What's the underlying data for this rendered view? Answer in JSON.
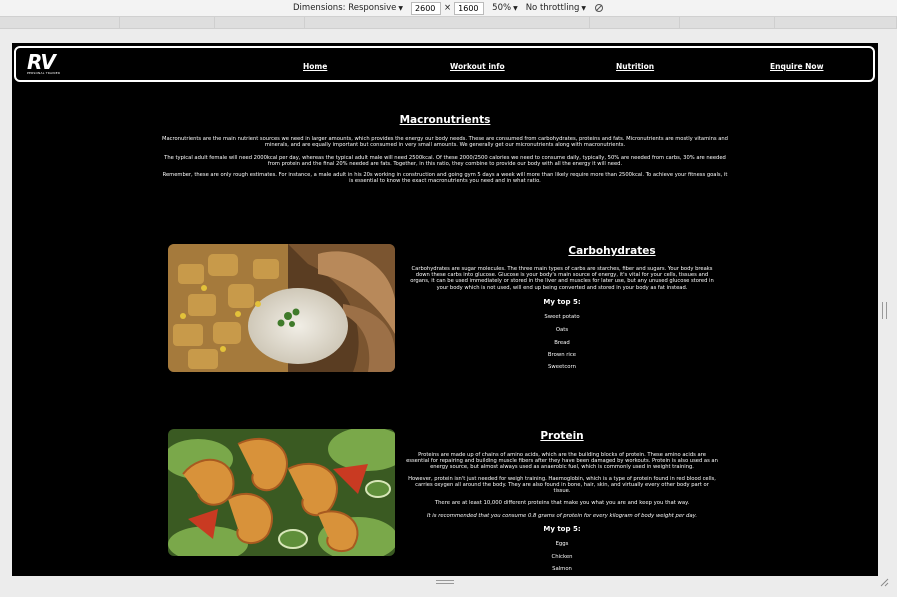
{
  "devtools": {
    "dimensions_label": "Dimensions: Responsive",
    "width": "2600",
    "times": "×",
    "height": "1600",
    "zoom": "50%",
    "throttling": "No throttling"
  },
  "nav": {
    "logo_text": "RV",
    "logo_sub": "PERSONAL TRAINER",
    "links": [
      "Home",
      "Workout info",
      "Nutrition",
      "Enquire Now"
    ]
  },
  "macro": {
    "title": "Macronutrients",
    "p1": "Macronutrients are the main nutrient sources we need in larger amounts, which provides the energy our body needs. These are consumed from carbohydrates, proteins and fats. Micronutrients are mostly vitamins and minerals, and are equally important but consumed in very small amounts. We generally get our micronutrients along with macronutrients.",
    "p2": "The typical adult female will need 2000kcal per day, whereas the typical adult male will need 2500kcal. Of these 2000/2500 calories we need to consume daily, typically, 50% are needed from carbs, 30% are needed from protein and the final 20% needed are fats. Together, in this ratio, they combine to provide our body with all the energy it will need.",
    "p3": "Remember, these are only rough estimates. For instance, a male adult in his 20s working in construction and going gym 5 days a week will more than likely require more than 2500kcal. To achieve your fitness goals, it is essential to know the exact macronutrients you need and in what ratio."
  },
  "carbs": {
    "title": "Carbohydrates",
    "p1": "Carbohydrates are sugar molecules. The three main types of carbs are starches, fiber and sugars. Your body breaks down these carbs into glucose. Glucose is your body's main source of energy, it's vital for your cells, tissues and organs, it can be used immediately or stored in the liver and muscles for later use, but any unused glucose stored in your body which is not used, will end up being converted and stored in your body as fat instead.",
    "top5_label": "My top 5:",
    "top5": [
      "Sweet potato",
      "Oats",
      "Bread",
      "Brown rice",
      "Sweetcorn"
    ]
  },
  "protein": {
    "title": "Protein",
    "p1": "Proteins are made up of chains of amino acids, which are the building blocks of protein. These amino acids are essential for repairing and building muscle fibers after they have been damaged by workouts. Protein is also used as an energy source, but almost always used as anaerobic fuel, which is commonly used in weight training.",
    "p2": "However, protein isn't just needed for weigh training. Haemoglobin, which is a type of protein found in red blood cells, carries oxygen all around the body. They are also found in bone, hair, skin, and virtually every other body part or tissue.",
    "p3": "There are at least 10,000 different proteins that make you what you are and keep you that way.",
    "p4": "It is recommended that you consume 0.8 grams of protein for every kilogram of body weight per day.",
    "top5_label": "My top 5:",
    "top5": [
      "Eggs",
      "Chicken",
      "Salmon"
    ]
  },
  "colors": {
    "page_bg": "#000000",
    "text": "#ffffff",
    "chrome_bg": "#ececec"
  }
}
